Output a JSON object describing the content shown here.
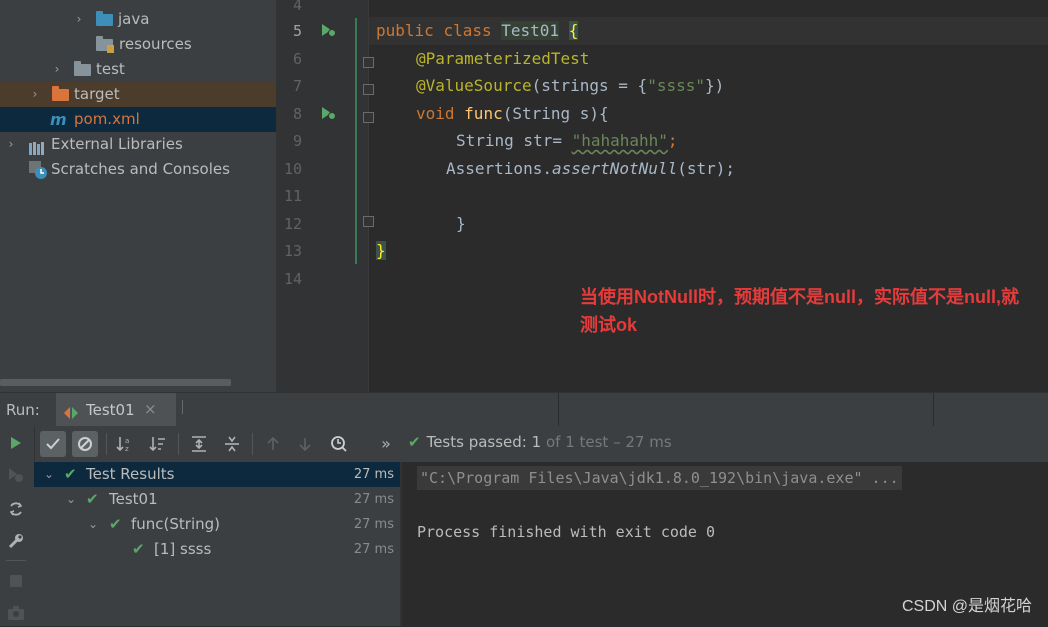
{
  "project_tree": {
    "items": [
      {
        "label": "java",
        "arrow": "›",
        "icon": "folder-icon",
        "color": "#3d8eb9"
      },
      {
        "label": "resources",
        "arrow": "",
        "icon": "resources-folder-icon",
        "color": "#87939a"
      },
      {
        "label": "test",
        "arrow": "›",
        "icon": "folder-icon",
        "color": "#87939a"
      },
      {
        "label": "target",
        "arrow": "›",
        "icon": "folder-icon",
        "color": "#d9743c"
      },
      {
        "label": "pom.xml",
        "arrow": "",
        "icon": "maven-icon",
        "color": "#d9743c"
      },
      {
        "label": "External Libraries",
        "arrow": "›",
        "icon": "libraries-icon",
        "color": "#bbbbbb"
      },
      {
        "label": "Scratches and Consoles",
        "arrow": "",
        "icon": "scratches-icon",
        "color": "#bbbbbb"
      }
    ]
  },
  "editor": {
    "line_numbers": [
      "4",
      "5",
      "6",
      "7",
      "8",
      "9",
      "10",
      "11",
      "12",
      "13",
      "14"
    ],
    "current_line": "5",
    "code": {
      "l5_kw1": "public",
      "l5_kw2": "class",
      "l5_cls": "Test01",
      "l5_brace": "{",
      "l6_ann": "@ParameterizedTest",
      "l7_ann": "@ValueSource",
      "l7_rest_a": "(strings = {",
      "l7_str": "\"ssss\"",
      "l7_rest_b": "})",
      "l8_kw": "void",
      "l8_fn": "func",
      "l8_rest": "(String s){",
      "l9_a": "String str= ",
      "l9_str": "\"hahahahh\"",
      "l9_semi": ";",
      "l10_a": "Assertions.",
      "l10_fn": "assertNotNull",
      "l10_b": "(str);",
      "l12_brace": "}",
      "l13_brace": "}"
    },
    "note": "当使用NotNull时，预期值不是null，实际值不是null,就测试ok"
  },
  "run_panel": {
    "label": "Run:",
    "tab": "Test01",
    "tab_close": "×",
    "status": {
      "check": "✔",
      "prefix": "Tests passed:",
      "count": "1",
      "suffix": "of 1 test – 27 ms"
    },
    "more": "»",
    "results": [
      {
        "label": "Test Results",
        "time": "27 ms"
      },
      {
        "label": "Test01",
        "time": "27 ms"
      },
      {
        "label": "func(String)",
        "time": "27 ms"
      },
      {
        "label": "[1] ssss",
        "time": "27 ms"
      }
    ],
    "console": {
      "command": "\"C:\\Program Files\\Java\\jdk1.8.0_192\\bin\\java.exe\" ...",
      "exit": "Process finished with exit code 0"
    }
  },
  "watermark": "CSDN @是烟花哈",
  "colors": {
    "accent_green": "#59a869",
    "keyword": "#cc7832",
    "annotation": "#bbb529",
    "string": "#6a8759",
    "method": "#ffc66d",
    "note_red": "#e53b3b"
  }
}
